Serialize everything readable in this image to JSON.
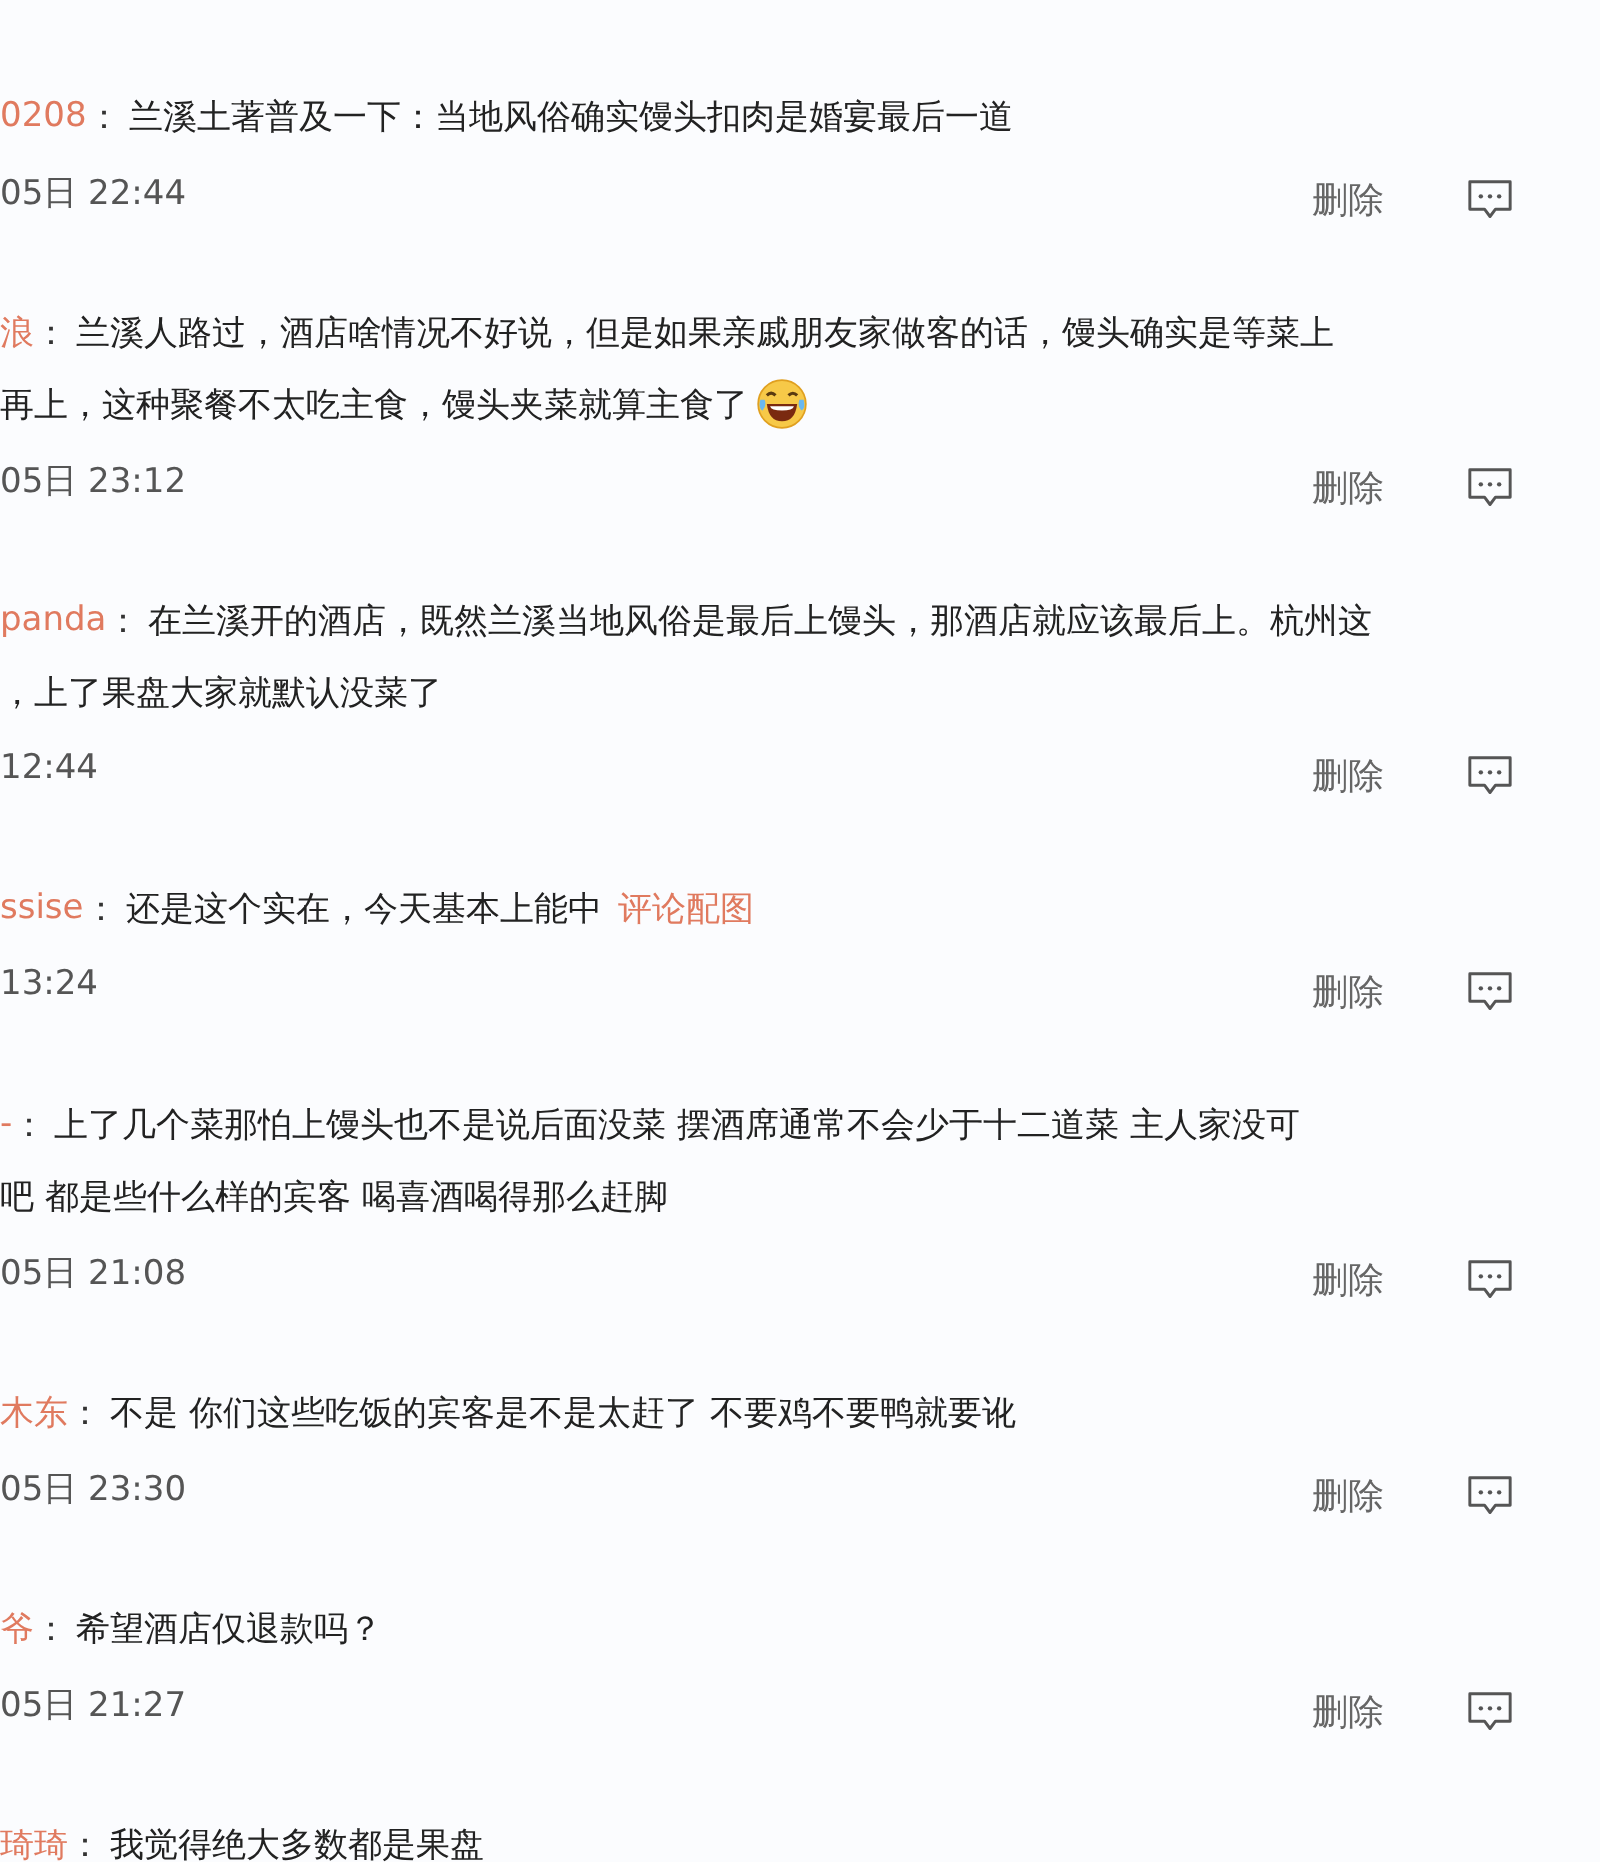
{
  "comments": [
    {
      "author": "0208",
      "sep": "：",
      "lines": [
        "兰溪土著普及一下：当地风俗确实馒头扣肉是婚宴最后一道"
      ],
      "time": "05日 22:44",
      "delete": "删除"
    },
    {
      "author": "浪",
      "sep": "：",
      "lines": [
        "兰溪人路过，酒店啥情况不好说，但是如果亲戚朋友家做客的话，馒头确实是等菜上",
        "再上，这种聚餐不太吃主食，馒头夹菜就算主食了"
      ],
      "emoji": true,
      "time": "05日 23:12",
      "delete": "删除"
    },
    {
      "author": "panda",
      "sep": "：",
      "lines": [
        "在兰溪开的酒店，既然兰溪当地风俗是最后上馒头，那酒店就应该最后上。杭州这",
        "，上了果盘大家就默认没菜了"
      ],
      "time": "12:44",
      "delete": "删除"
    },
    {
      "author": "ssise",
      "sep": "：",
      "lines": [
        "还是这个实在，今天基本上能中"
      ],
      "link": "评论配图",
      "time": "13:24",
      "delete": "删除"
    },
    {
      "author": "-",
      "sep": "：",
      "lines": [
        "上了几个菜那怕上馒头也不是说后面没菜 摆酒席通常不会少于十二道菜 主人家没可",
        "吧 都是些什么样的宾客 喝喜酒喝得那么赶脚"
      ],
      "time": "05日 21:08",
      "delete": "删除"
    },
    {
      "author": "木东",
      "sep": "：",
      "lines": [
        "不是 你们这些吃饭的宾客是不是太赶了 不要鸡不要鸭就要讹"
      ],
      "time": "05日 23:30",
      "delete": "删除"
    },
    {
      "author": "爷",
      "sep": "：",
      "lines": [
        "希望酒店仅退款吗？"
      ],
      "time": "05日 21:27",
      "delete": "删除"
    },
    {
      "author": "琦琦",
      "sep": "：",
      "lines": [
        "我觉得绝大多数都是果盘"
      ]
    }
  ]
}
